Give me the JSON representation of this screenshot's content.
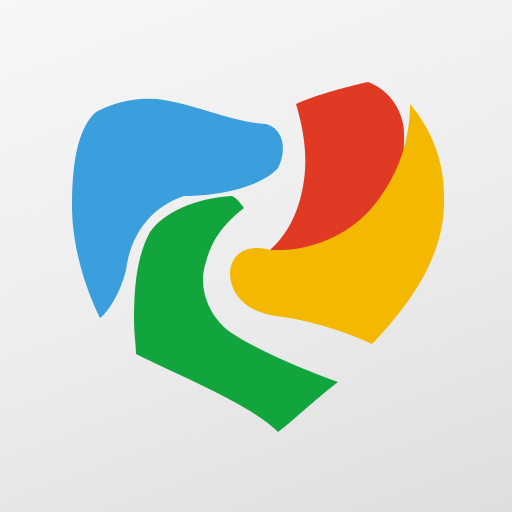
{
  "icon": {
    "name": "heart-swirl-logo",
    "colors": {
      "background_light": "#f7f7f7",
      "background_dark": "#dedede",
      "blue": "#3a9fdc",
      "red": "#e03a24",
      "yellow": "#f4b800",
      "green": "#12a53d"
    }
  }
}
